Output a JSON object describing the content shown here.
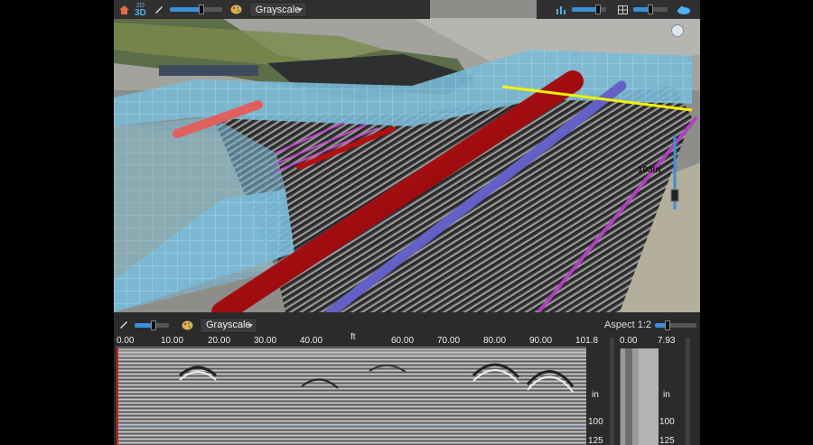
{
  "toolbar": {
    "view_toggle_top": "2D",
    "view_toggle_bottom": "3D",
    "colormap": "Grayscale"
  },
  "overlay": {
    "depth_badge": "103in"
  },
  "panel": {
    "colormap": "Grayscale",
    "aspect_label": "Aspect 1:2",
    "ruler_unit": "ft",
    "ruler_ticks": [
      "0.00",
      "10.00",
      "20.00",
      "30.00",
      "40.00",
      "60.00",
      "70.00",
      "80.00",
      "90.00",
      "101.8"
    ],
    "side_ruler_ticks": [
      "0.00",
      "7.93"
    ],
    "depth_unit": "in",
    "depth_labels": [
      "100",
      "125"
    ],
    "side_depth_unit": "in",
    "side_depth_labels": [
      "100",
      "125"
    ]
  },
  "colors": {
    "accent": "#3a8fd8",
    "pipe_red": "#b40f12",
    "pipe_blue": "#5a57c8",
    "pipe_magenta": "#b240c0",
    "marker_yellow": "#f2f200",
    "wall": "#7fbfdc"
  },
  "icons": {
    "home": "home-icon",
    "layers": "layers-icon",
    "palette": "palette-icon",
    "chart": "bar-chart-icon",
    "grid": "grid-icon",
    "cloud": "cloud-icon",
    "compass": "compass-icon"
  },
  "sliders": {
    "top_opacity": 0.6,
    "right_a": 0.75,
    "right_b": 0.5,
    "panel_opacity": 0.55,
    "aspect": 0.3,
    "depth_handle": 0.55
  }
}
